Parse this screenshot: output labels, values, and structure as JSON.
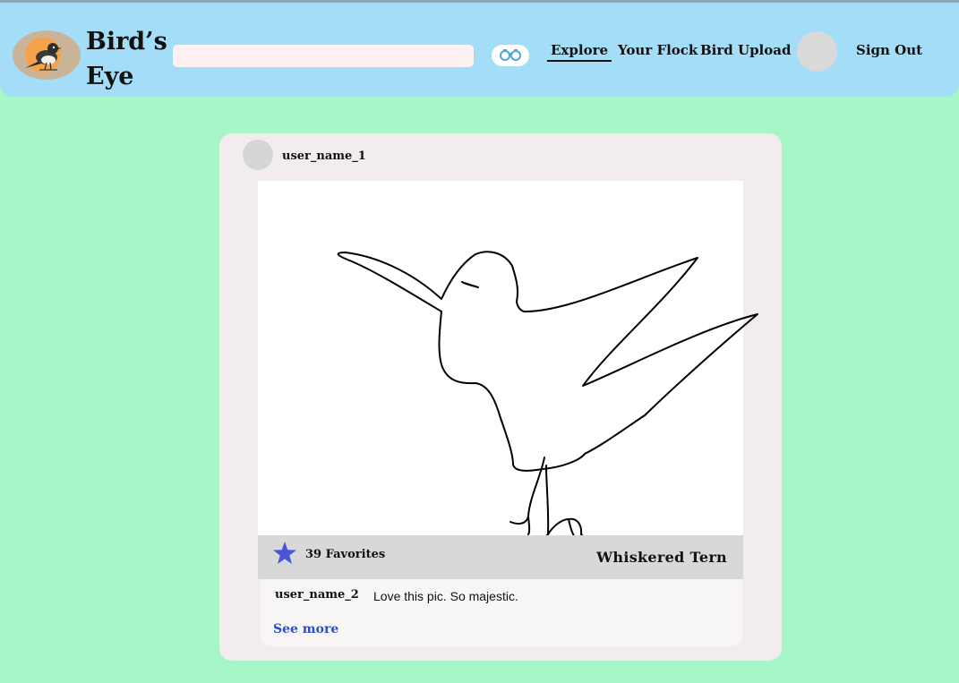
{
  "header": {
    "brand": "Bird’s Eye",
    "brand_line1": "Bird’s",
    "brand_line2": "Eye",
    "logo_icon": "bird-logo",
    "search": {
      "value": "",
      "placeholder": ""
    },
    "search_button_icon": "binoculars-icon",
    "nav": {
      "explore": "Explore",
      "your_flock": "Your Flock",
      "bird_upload": "Bird Upload",
      "sign_out": "Sign Out"
    },
    "active_nav": "Explore"
  },
  "post": {
    "username": "user_name_1",
    "image_icon": "bird-drawing",
    "favorites_label": "39 Favorites",
    "favorites_count": 39,
    "favorite_icon": "star-icon",
    "bird_name": "Whiskered Tern",
    "comment": {
      "username": "user_name_2",
      "text": "Love this pic. So majestic."
    },
    "see_more": "See more"
  },
  "colors": {
    "page_background": "#a6f6c7",
    "header_background": "#a4ddf7",
    "card_background": "#f2ecec",
    "star": "#4a55d8",
    "link": "#2a4fc4"
  }
}
